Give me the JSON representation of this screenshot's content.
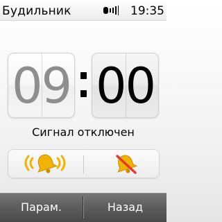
{
  "status_bar": {
    "title": "Будильник",
    "time": "19:35",
    "signal_icon": "signal-strength-icon"
  },
  "alarm": {
    "hours": "09",
    "minutes": "00",
    "status": "Сигнал отключен",
    "enabled": false,
    "on_icon": "ringing-bell-icon",
    "off_icon": "muted-bell-icon",
    "bell_color": "#f2b300",
    "off_mark_color": "#e53a2b"
  },
  "softkeys": {
    "left": "Парам.",
    "right": "Назад"
  }
}
